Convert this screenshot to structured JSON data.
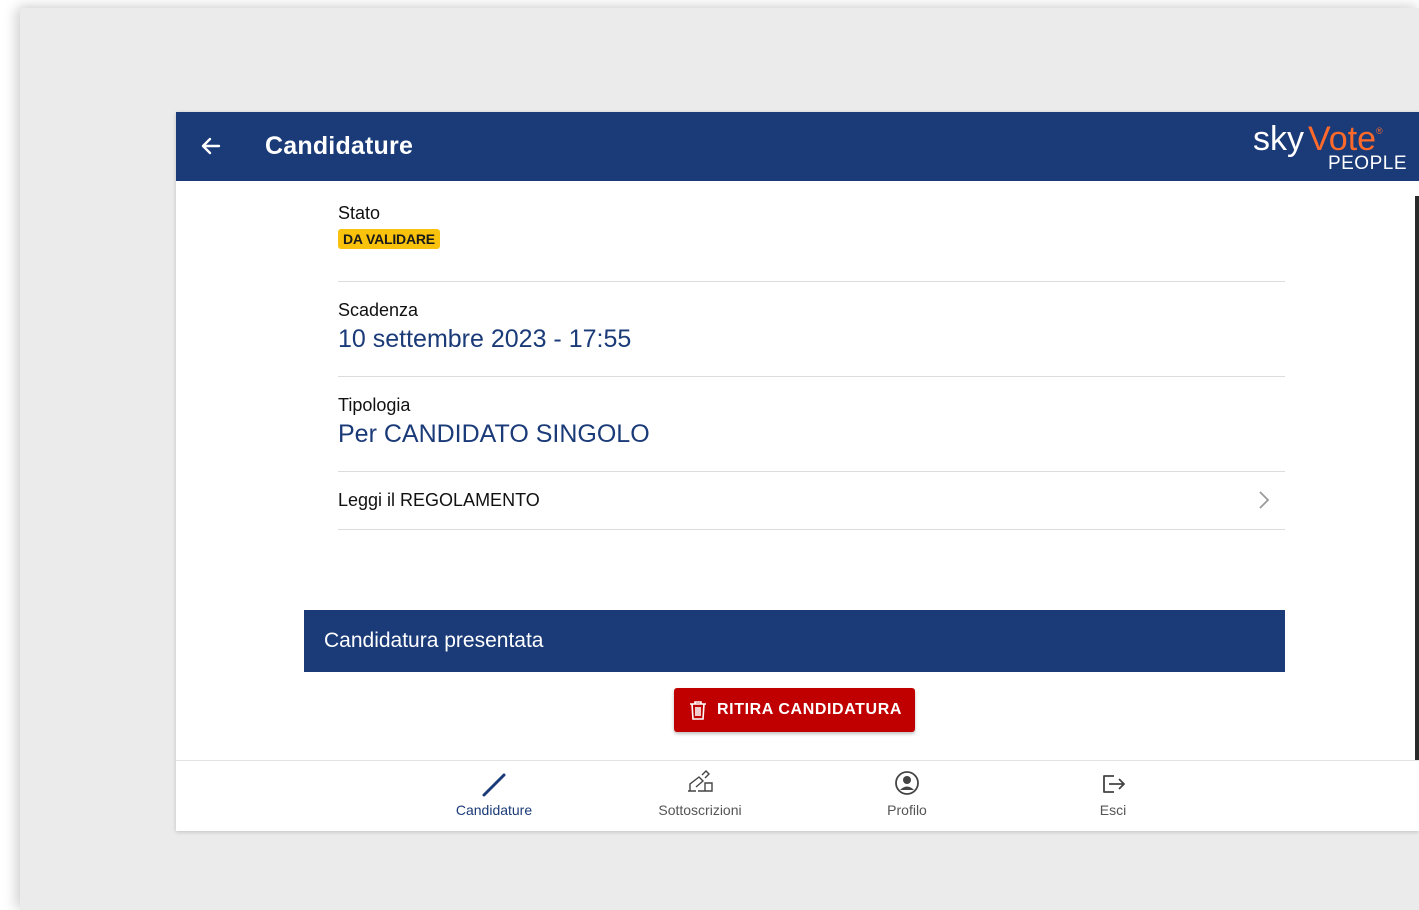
{
  "header": {
    "title": "Candidature",
    "logo": {
      "sky": "sky",
      "vote": "Vote",
      "reg": "®",
      "people": "PEOPLE"
    },
    "colors": {
      "primary": "#1a3a78",
      "accent": "#ff6a2a"
    }
  },
  "details": {
    "stato": {
      "label": "Stato",
      "badge": "DA VALIDARE"
    },
    "scadenza": {
      "label": "Scadenza",
      "value": "10 settembre 2023 - 17:55"
    },
    "tipologia": {
      "label": "Tipologia",
      "value": "Per CANDIDATO SINGOLO"
    },
    "regolamento": {
      "label": "Leggi il REGOLAMENTO"
    }
  },
  "banner": {
    "text": "Candidatura presentata"
  },
  "actions": {
    "withdraw_label": "RITIRA CANDIDATURA",
    "withdraw_color": "#c00000"
  },
  "nav": {
    "items": [
      {
        "label": "Candidature",
        "icon": "pencil-icon",
        "active": true
      },
      {
        "label": "Sottoscrizioni",
        "icon": "signature-icon",
        "active": false
      },
      {
        "label": "Profilo",
        "icon": "user-circle-icon",
        "active": false
      },
      {
        "label": "Esci",
        "icon": "logout-icon",
        "active": false
      }
    ]
  }
}
